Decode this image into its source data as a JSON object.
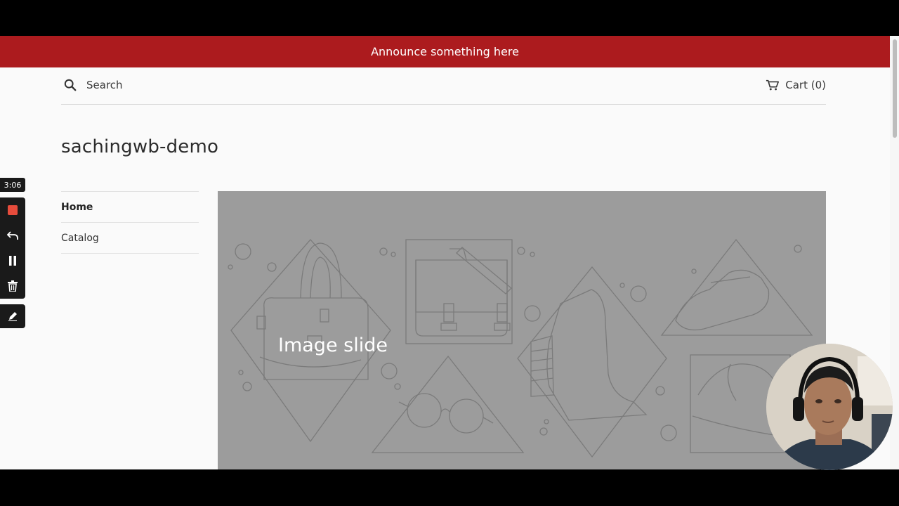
{
  "announcement": {
    "text": "Announce something here"
  },
  "header": {
    "search_label": "Search",
    "cart_label": "Cart (0)"
  },
  "site": {
    "title": "sachingwb-demo"
  },
  "nav": {
    "items": [
      {
        "label": "Home",
        "active": true
      },
      {
        "label": "Catalog",
        "active": false
      }
    ]
  },
  "slideshow": {
    "text": "Image slide"
  },
  "recorder": {
    "timer": "3:06"
  },
  "colors": {
    "announcement_bg": "#ac1b1e",
    "slide_bg": "#9c9c9c",
    "record": "#e74c3c"
  },
  "icons": [
    "search-icon",
    "cart-icon",
    "stop-icon",
    "undo-icon",
    "pause-icon",
    "trash-icon",
    "pen-icon"
  ]
}
